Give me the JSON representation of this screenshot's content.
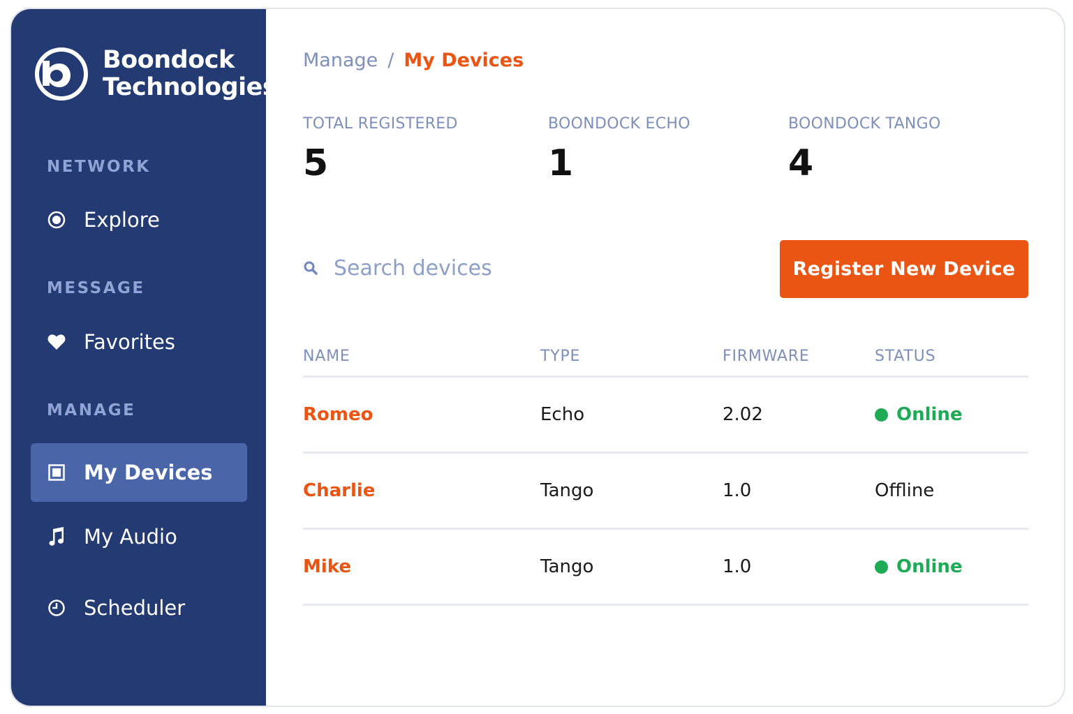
{
  "brand": {
    "line1": "Boondock",
    "line2": "Technologies",
    "logo_icon": "boondock-b-logo-icon"
  },
  "sidebar": {
    "sections": [
      {
        "title": "NETWORK",
        "items": [
          {
            "label": "Explore",
            "icon": "radio-target-icon"
          }
        ]
      },
      {
        "title": "MESSAGE",
        "items": [
          {
            "label": "Favorites",
            "icon": "heart-icon"
          }
        ]
      },
      {
        "title": "MANAGE",
        "items": [
          {
            "label": "My Devices",
            "icon": "device-icon",
            "active": true
          },
          {
            "label": "My Audio",
            "icon": "music-note-icon"
          },
          {
            "label": "Scheduler",
            "icon": "clock-icon"
          }
        ]
      }
    ]
  },
  "breadcrumb": {
    "parent": "Manage",
    "separator": "/",
    "current": "My Devices"
  },
  "stats": [
    {
      "label": "TOTAL REGISTERED",
      "value": "5"
    },
    {
      "label": "BOONDOCK ECHO",
      "value": "1"
    },
    {
      "label": "BOONDOCK TANGO",
      "value": "4"
    }
  ],
  "search": {
    "placeholder": "Search devices",
    "value": ""
  },
  "register_button": {
    "label": "Register New Device"
  },
  "table": {
    "columns": [
      "NAME",
      "TYPE",
      "FIRMWARE",
      "STATUS"
    ],
    "rows": [
      {
        "name": "Romeo",
        "type": "Echo",
        "firmware": "2.02",
        "status": "Online"
      },
      {
        "name": "Charlie",
        "type": "Tango",
        "firmware": "1.0",
        "status": "Offline"
      },
      {
        "name": "Mike",
        "type": "Tango",
        "firmware": "1.0",
        "status": "Online"
      }
    ]
  },
  "colors": {
    "sidebar_bg": "#233a72",
    "sidebar_active": "#4a65a8",
    "section_title": "#8fa3d4",
    "accent": "#ea5514",
    "online": "#1faa56",
    "muted_text": "#7d8fba"
  }
}
